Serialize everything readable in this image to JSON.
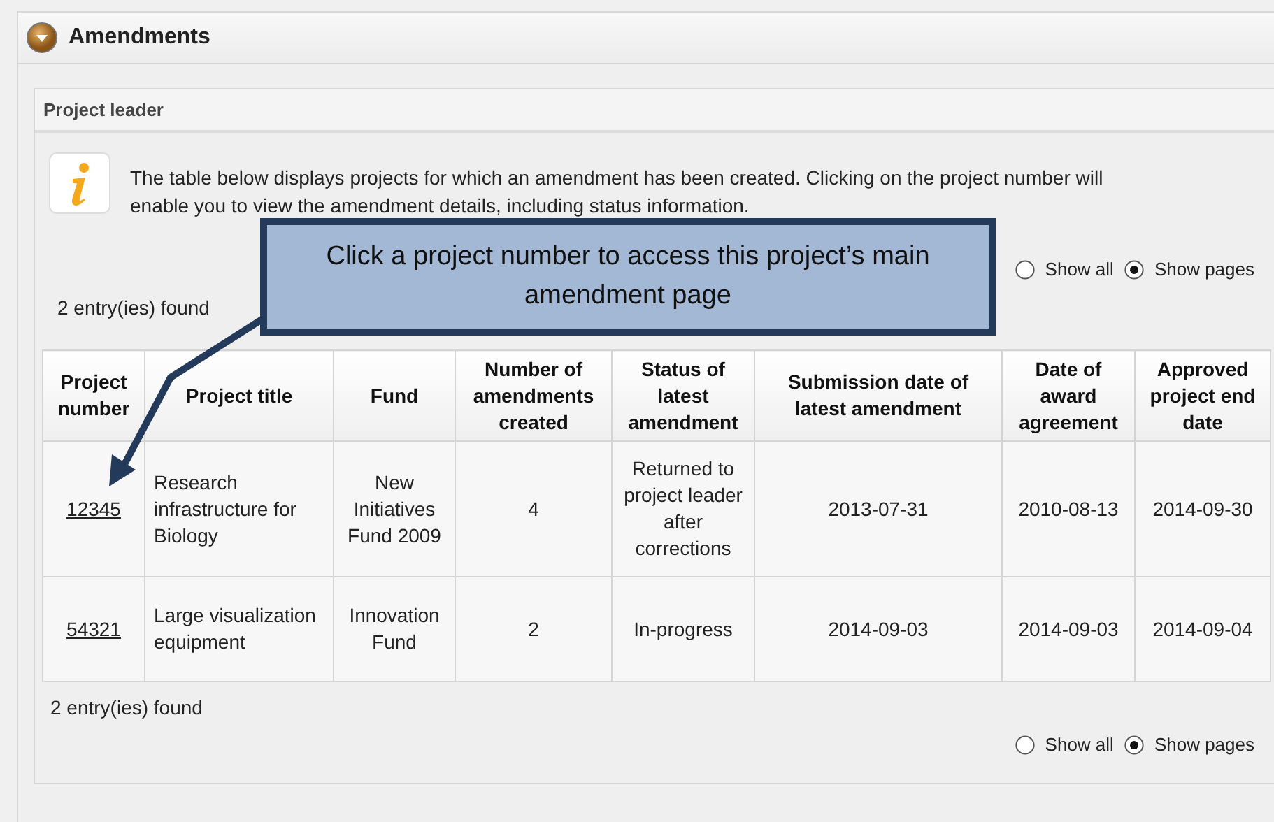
{
  "panel": {
    "title": "Amendments",
    "expanded": true
  },
  "section": {
    "title": "Project leader"
  },
  "info": "The table below displays projects for which an amendment has been created. Clicking on the project number will enable you to view the amendment details, including status information.",
  "top_view_options": [
    {
      "label": "Show all",
      "selected": false
    },
    {
      "label": "Show pages",
      "selected": true
    }
  ],
  "top_count": "2 entry(ies) found",
  "table": {
    "columns": [
      "Project number",
      "Project title",
      "Fund",
      "Number of amendments created",
      "Status of latest amendment",
      "Submission date of latest amendment",
      "Date of award agreement",
      "Approved project end date"
    ],
    "rows": [
      {
        "cells": [
          "12345",
          "Research infrastructure for Biology",
          "New Initiatives Fund 2009",
          "4",
          "Returned to project leader after corrections",
          "2013-07-31",
          "2010-08-13",
          "2014-09-30"
        ]
      },
      {
        "cells": [
          "54321",
          "Large visualization equipment",
          "Innovation Fund",
          "2",
          "In-progress",
          "2014-09-03",
          "2014-09-03",
          "2014-09-04"
        ]
      }
    ]
  },
  "bottom_count": "2 entry(ies) found",
  "bottom_view_options": [
    {
      "label": "Show all",
      "selected": false
    },
    {
      "label": "Show pages",
      "selected": true
    }
  ],
  "callout": {
    "text": "Click a project number to access this project’s main amendment page"
  }
}
